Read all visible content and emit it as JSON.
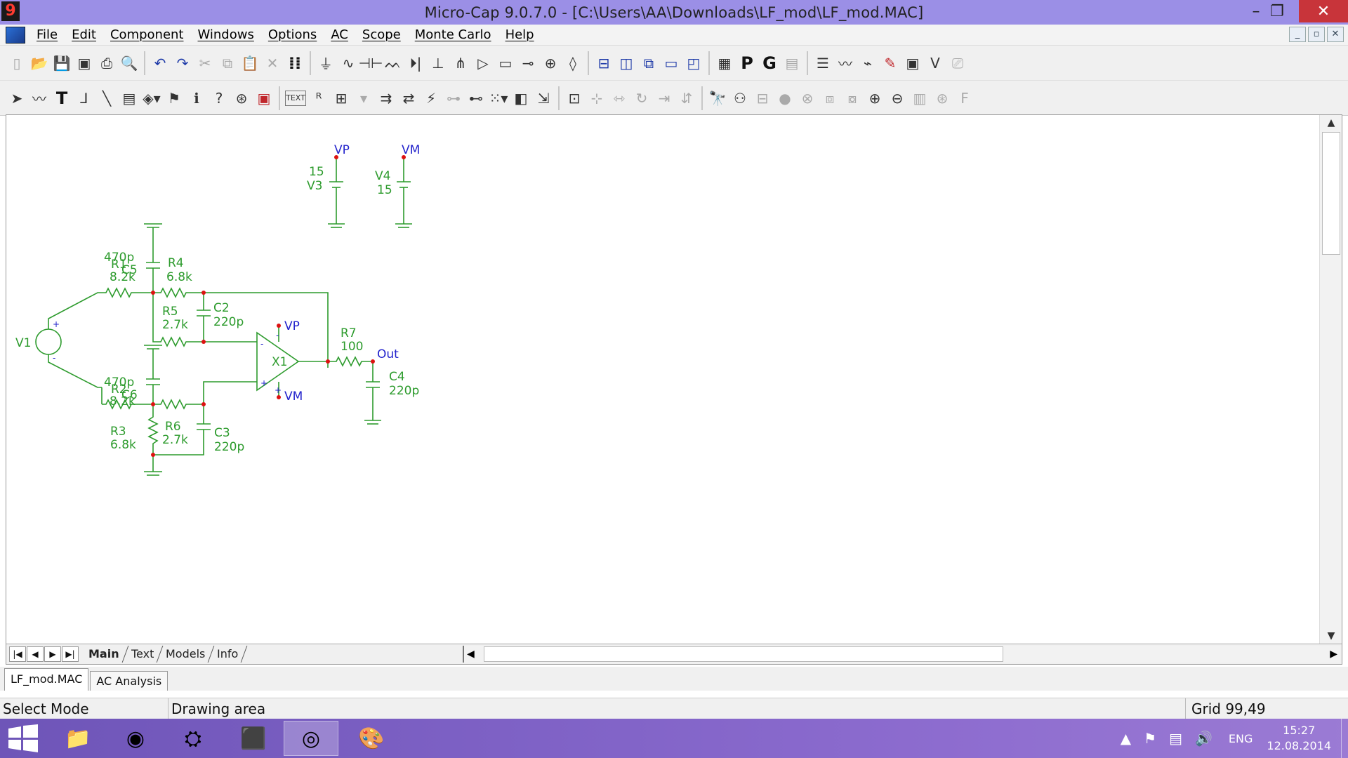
{
  "window": {
    "title": "Micro-Cap 9.0.7.0 - [C:\\Users\\AA\\Downloads\\LF_mod\\LF_mod.MAC]",
    "app_icon_glyph": "9",
    "minimize_glyph": "–",
    "maximize_glyph": "❐",
    "close_glyph": "✕"
  },
  "menu": {
    "items": [
      "File",
      "Edit",
      "Component",
      "Windows",
      "Options",
      "AC",
      "Scope",
      "Monte Carlo",
      "Help"
    ],
    "mdi_minimize": "_",
    "mdi_restore": "▫",
    "mdi_close": "✕"
  },
  "toolbar1": {
    "icons": [
      "new-icon",
      "open-icon",
      "save-icon",
      "save-all-icon",
      "print-icon",
      "print-preview-icon",
      "undo-icon",
      "redo-icon",
      "cut-icon",
      "copy-icon",
      "paste-icon",
      "clear-icon",
      "select-all-icon",
      "ground-icon",
      "resistor-icon",
      "capacitor-icon",
      "inductor-icon",
      "diode-icon",
      "battery-icon",
      "transistor-icon",
      "opamp-icon",
      "battery2-icon",
      "wire-icon",
      "source-icon",
      "sine-source-icon",
      "tile-horizontal-icon",
      "tile-vertical-icon",
      "cascade-icon",
      "window-icon",
      "split-icon",
      "calculator-icon",
      "probe-p-icon",
      "probe-g-icon",
      "grid-icon",
      "attributes-icon",
      "waveform-icon",
      "component-edit-icon",
      "pencil-icon",
      "analysis-icon",
      "variable-icon",
      "info-icon"
    ],
    "probe_p": "P",
    "probe_g": "G"
  },
  "toolbar2": {
    "text_label": "TEXT"
  },
  "schematic": {
    "wire_color": "#2d9b2d",
    "label_color": "#2d9b2d",
    "net_color": "#2222cc",
    "node_color": "#dd1111",
    "components": {
      "vp_net": "VP",
      "vm_net": "VM",
      "v3_name": "V3",
      "v3_value": "15",
      "v4_name": "V4",
      "v4_value": "15",
      "r1_name": "R1",
      "r1_value": "8.2k",
      "c5_name": "C5",
      "c5_value": "470p",
      "r4_name": "R4",
      "r4_value": "6.8k",
      "r5_name": "R5",
      "r5_value": "2.7k",
      "c2_name": "C2",
      "c2_value": "220p",
      "v1_name": "V1",
      "v1_plus": "+",
      "v1_minus": "-",
      "x1_name": "X1",
      "x1_vp": "VP",
      "x1_vm": "VM",
      "x1_minus_in": "-",
      "x1_plus_in": "+",
      "x1_minus_sup": "-",
      "x1_plus_sup": "+",
      "r7_name": "R7",
      "r7_value": "100",
      "out_net": "Out",
      "c4_name": "C4",
      "c4_value": "220p",
      "r2_name": "R2",
      "r2_value": "8.2k",
      "c6_name": "C6",
      "c6_value": "470p",
      "r6_name": "R6",
      "r6_value": "2.7k",
      "r3_name": "R3",
      "r3_value": "6.8k",
      "c3_name": "C3",
      "c3_value": "220p"
    }
  },
  "page_tabs": [
    "Main",
    "Text",
    "Models",
    "Info"
  ],
  "active_page_tab": "Main",
  "doc_tabs": [
    "LF_mod.MAC",
    "AC Analysis"
  ],
  "status": {
    "mode": "Select Mode",
    "area": "Drawing area",
    "grid": "Grid 99,49"
  },
  "taskbar": {
    "lang": "ENG",
    "time": "15:27",
    "date": "12.08.2014"
  }
}
